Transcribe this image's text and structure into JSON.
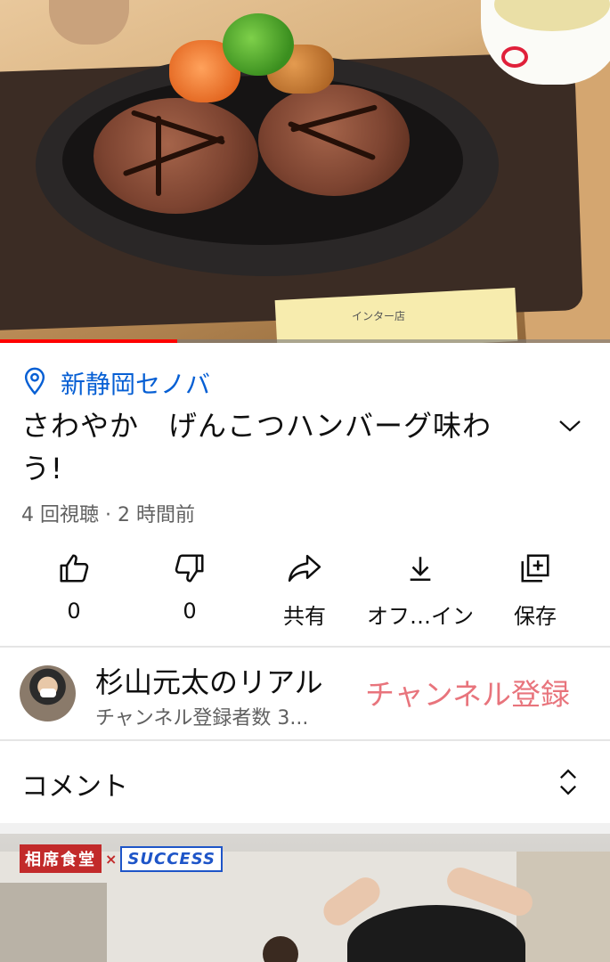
{
  "video": {
    "progress": 0.29,
    "thumbnail_sign_text": "インター店"
  },
  "location": {
    "label": "新静岡セノバ",
    "icon": "location-pin-icon"
  },
  "title": "さわやか　げんこつハンバーグ味わう!",
  "meta": "4 回視聴 · 2 時間前",
  "actions": [
    {
      "id": "like",
      "icon": "thumb-up-icon",
      "label": "0"
    },
    {
      "id": "dislike",
      "icon": "thumb-down-icon",
      "label": "0"
    },
    {
      "id": "share",
      "icon": "share-icon",
      "label": "共有"
    },
    {
      "id": "offline",
      "icon": "download-icon",
      "label": "オフ…イン"
    },
    {
      "id": "save",
      "icon": "playlist-add-icon",
      "label": "保存"
    }
  ],
  "channel": {
    "name": "杉山元太のリアル",
    "subscribers": "チャンネル登録者数 3...",
    "subscribe_label": "チャンネル登録"
  },
  "comments": {
    "label": "コメント"
  },
  "next_video": {
    "badge_left": "相席食堂",
    "badge_x": "×",
    "badge_right": "SUCCESS"
  },
  "colors": {
    "link": "#065fd4",
    "subscribe": "#e8747c",
    "progress": "#ff0000"
  }
}
